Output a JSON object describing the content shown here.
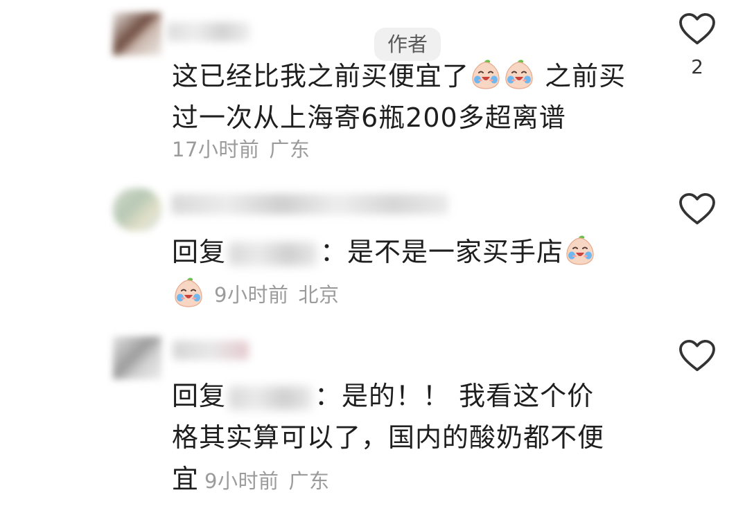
{
  "comments": [
    {
      "author_badge": "作者",
      "text_before_emoji": "这已经比我之前买便宜了",
      "text_after_emoji": " 之前买过一次从上海寄6瓶200多超离谱",
      "time": "17小时前",
      "location": "广东",
      "like_count": "2",
      "emoji": "crying-peach-emoji"
    },
    {
      "reply_prefix": "回复",
      "reply_colon": "：",
      "text": "是不是一家买手店",
      "time": "9小时前",
      "location": "北京",
      "emoji": "crying-peach-emoji"
    },
    {
      "reply_prefix": "回复",
      "reply_colon": "：",
      "text_line1": "是的！！ 我看这个价",
      "text_line2": "格其实算可以了，国内的酸奶都不便",
      "text_line3": "宜",
      "time": "9小时前",
      "location": "广东"
    }
  ],
  "colors": {
    "text": "#1e1e1e",
    "meta": "#9b9b9b",
    "badge_bg": "#f0f0f0",
    "heart_stroke": "#333333"
  },
  "icons": {
    "like": "heart-outline-icon"
  }
}
